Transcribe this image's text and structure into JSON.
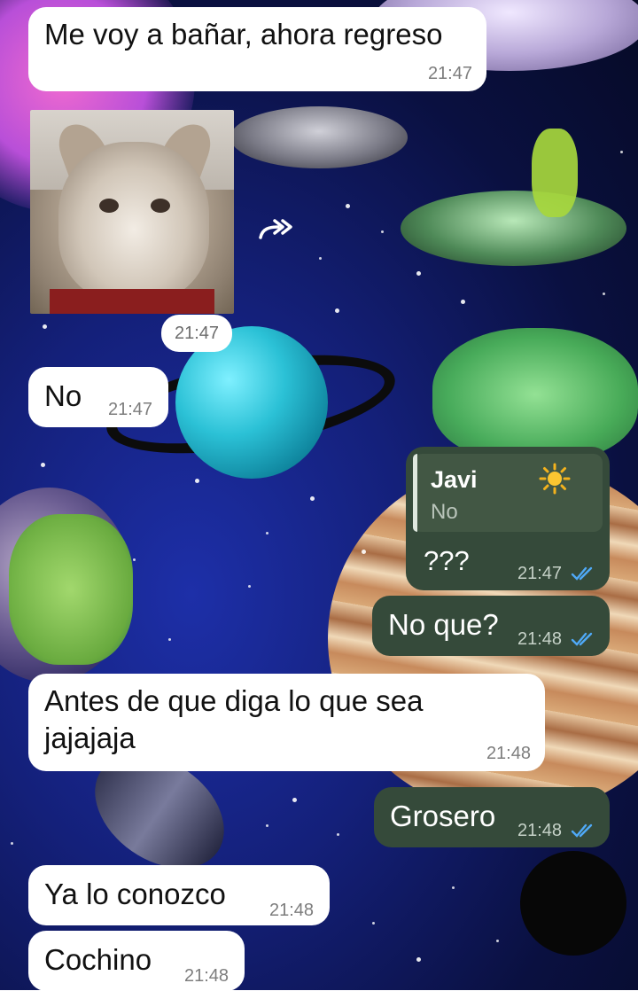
{
  "theme": {
    "incoming_bg": "#ffffff",
    "outgoing_bg": "#354a3a",
    "tick_color": "#4fa9f7"
  },
  "messages": [
    {
      "text": "Me voy a bañar, ahora regreso",
      "time": "21:47",
      "direction": "in"
    },
    {
      "type": "image",
      "image_alt": "cat-face-photo",
      "time": "21:47",
      "direction": "in",
      "forward_icon": "forward-icon"
    },
    {
      "text": "No",
      "time": "21:47",
      "direction": "in"
    },
    {
      "reply_to": {
        "name": "Javi",
        "emoji": "sun-icon",
        "text": "No"
      },
      "text": "???",
      "time": "21:47",
      "direction": "out",
      "status": "read"
    },
    {
      "text": "No que?",
      "time": "21:48",
      "direction": "out",
      "status": "read"
    },
    {
      "text_line1": "Antes de que diga lo que sea",
      "text_line2": "jajajaja",
      "time": "21:48",
      "direction": "in"
    },
    {
      "text": "Grosero",
      "time": "21:48",
      "direction": "out",
      "status": "read"
    },
    {
      "text": "Ya lo conozco",
      "time": "21:48",
      "direction": "in"
    },
    {
      "text": "Cochino",
      "time": "21:48",
      "direction": "in"
    }
  ]
}
